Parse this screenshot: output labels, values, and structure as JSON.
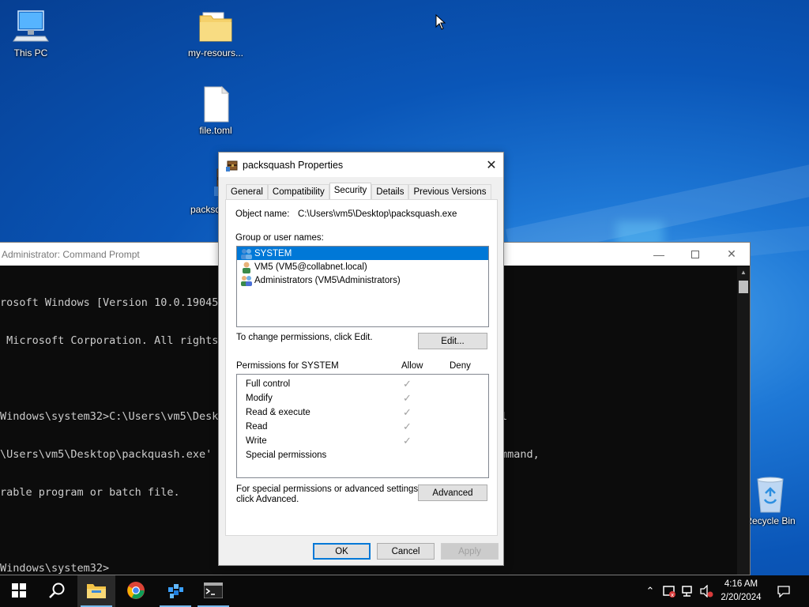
{
  "desktop": {
    "icons": [
      {
        "label": "This PC"
      },
      {
        "label": "my-resours..."
      },
      {
        "label": "file.toml"
      },
      {
        "label": "packsq"
      },
      {
        "label": "Recycle Bin"
      }
    ]
  },
  "cmd": {
    "title": "Administrator: Command Prompt",
    "lines": [
      "rosoft Windows [Version 10.0.19045.",
      " Microsoft Corporation. All rights",
      "",
      "Windows\\system32>C:\\Users\\vm5\\Deskt                                         oml",
      "\\Users\\vm5\\Desktop\\packquash.exe' i                                         command,",
      "rable program or batch file.",
      "",
      "Windows\\system32>"
    ]
  },
  "dialog": {
    "title": "packsquash Properties",
    "tabs": [
      "General",
      "Compatibility",
      "Security",
      "Details",
      "Previous Versions"
    ],
    "active_tab": "Security",
    "object_name_label": "Object name:",
    "object_name_value": "C:\\Users\\vm5\\Desktop\\packsquash.exe",
    "group_label": "Group or user names:",
    "users": [
      {
        "name": "SYSTEM",
        "selected": true
      },
      {
        "name": "VM5 (VM5@collabnet.local)",
        "selected": false
      },
      {
        "name": "Administrators (VM5\\Administrators)",
        "selected": false
      }
    ],
    "change_text": "To change permissions, click Edit.",
    "edit_button": "Edit...",
    "permissions_label": "Permissions for SYSTEM",
    "allow_label": "Allow",
    "deny_label": "Deny",
    "permissions": [
      {
        "name": "Full control",
        "allow": true
      },
      {
        "name": "Modify",
        "allow": true
      },
      {
        "name": "Read & execute",
        "allow": true
      },
      {
        "name": "Read",
        "allow": true
      },
      {
        "name": "Write",
        "allow": true
      },
      {
        "name": "Special permissions",
        "allow": false
      }
    ],
    "advanced_text_1": "For special permissions or advanced settings,",
    "advanced_text_2": "click Advanced.",
    "advanced_button": "Advanced",
    "ok_button": "OK",
    "cancel_button": "Cancel",
    "apply_button": "Apply"
  },
  "taskbar": {
    "time": "4:16 AM",
    "date": "2/20/2024"
  }
}
